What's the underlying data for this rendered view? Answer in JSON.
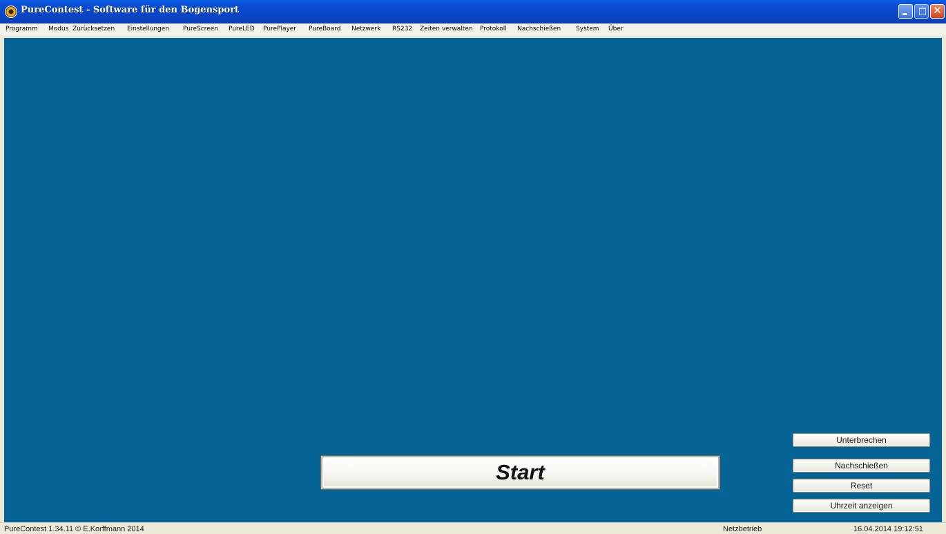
{
  "window": {
    "title": "PureContest - Software für den Bogensport",
    "close_glyph": "✕"
  },
  "menu": [
    "Programm",
    "Modus",
    "Zurücksetzen",
    "Einstellungen",
    "PureScreen",
    "PureLED",
    "PurePlayer",
    "PureBoard",
    "Netzwerk",
    "RS232",
    "Zeiten verwalten",
    "Protokoll",
    "Nachschießen",
    "System",
    "Über"
  ],
  "buttons": {
    "start": "Start",
    "unterbrechen": "Unterbrechen",
    "nachschiessen": "Nachschießen",
    "reset": "Reset",
    "uhrzeit": "Uhrzeit anzeigen"
  },
  "status": {
    "version": "PureContest 1.34.11 © E.Korffmann 2014",
    "mode": "Netzbetrieb",
    "datetime": "16.04.2014 19:12:51"
  },
  "colors": {
    "canvas": "#066396",
    "titlebar": "#0a4fd6"
  },
  "icons": [
    "app-icon",
    "minimize-icon",
    "maximize-icon",
    "close-icon"
  ]
}
